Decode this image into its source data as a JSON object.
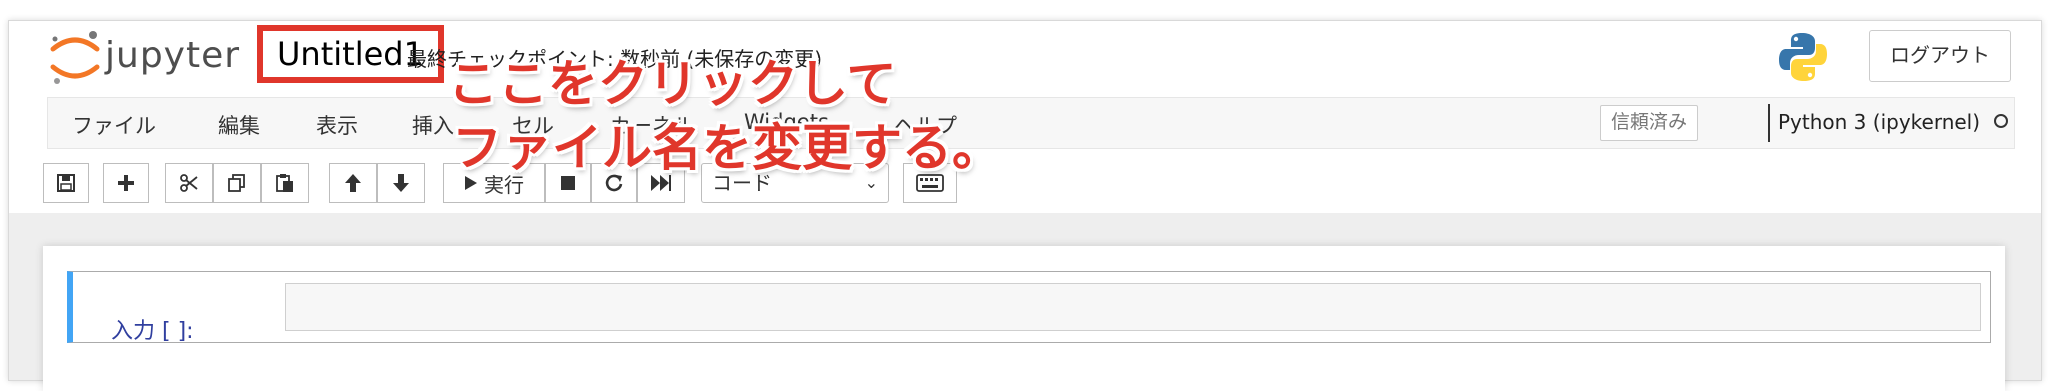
{
  "header": {
    "logo_text": "jupyter",
    "notebook_title": "Untitled1",
    "checkpoint_text": "最終チェックポイント: 数秒前 (未保存の変更)",
    "logout_label": "ログアウト"
  },
  "menubar": {
    "items": [
      {
        "label": "ファイル"
      },
      {
        "label": "編集"
      },
      {
        "label": "表示"
      },
      {
        "label": "挿入"
      },
      {
        "label": "セル"
      },
      {
        "label": "カーネル"
      },
      {
        "label": "Widgets"
      },
      {
        "label": "ヘルプ"
      }
    ],
    "trusted_label": "信頼済み",
    "kernel_name": "Python 3 (ipykernel)"
  },
  "toolbar": {
    "run_label": "実行",
    "cell_type": "コード"
  },
  "cell": {
    "prompt": "入力 [ ]:",
    "input_value": ""
  },
  "callout": {
    "line1": "ここをクリックして",
    "line2": "ファイル名を変更する。"
  },
  "colors": {
    "accent_red": "#e0362b",
    "cell_selected_border": "#42a5f5",
    "prompt_blue": "#303f9f"
  }
}
